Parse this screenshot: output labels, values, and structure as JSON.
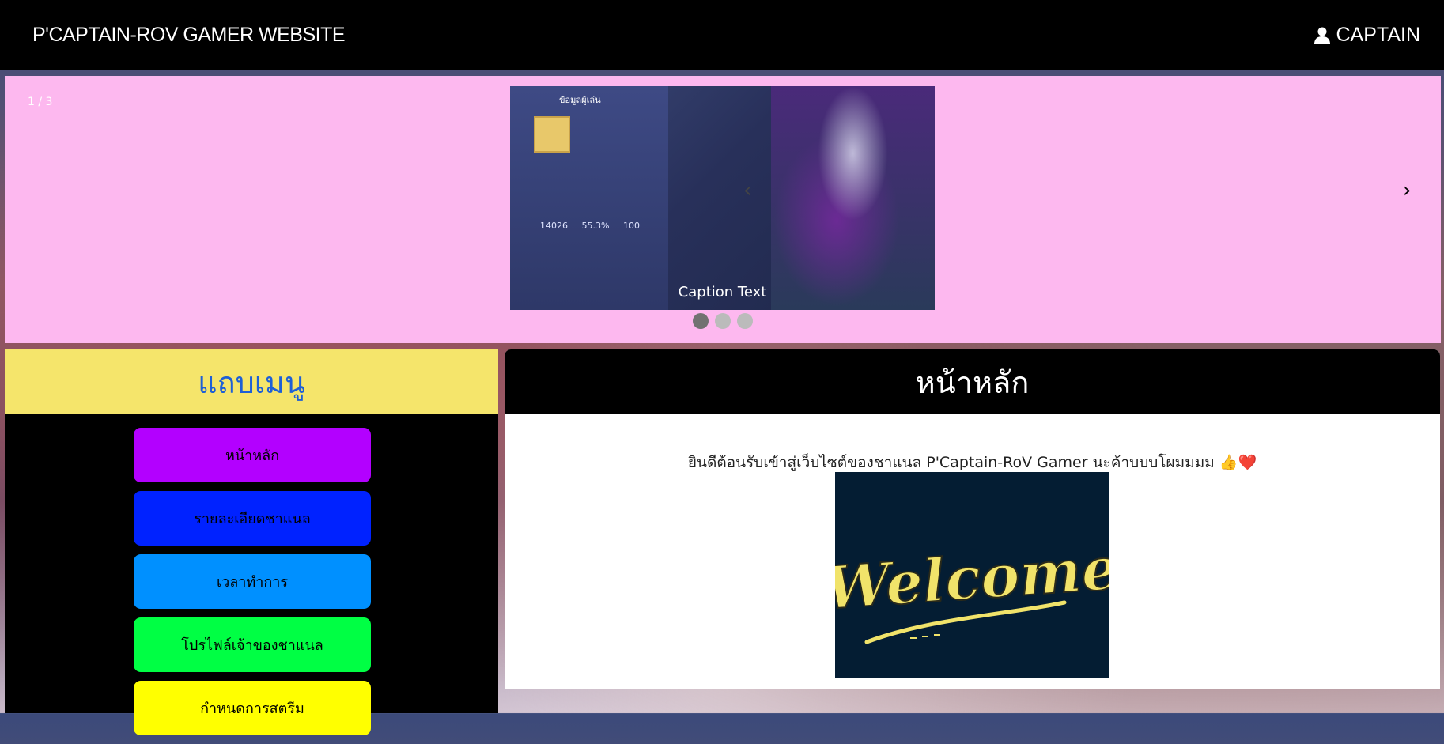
{
  "header": {
    "site_title": "P'CAPTAIN-ROV GAMER WEBSITE",
    "user_label": "CAPTAIN"
  },
  "slideshow": {
    "counter": "1 / 3",
    "caption": "Caption Text",
    "prev_symbol": "‹",
    "next_symbol": "›",
    "slide_count": 3,
    "active_index": 1,
    "game_ui": {
      "player_title": "ข้อมูลผู้เล่น",
      "stats": [
        "14026",
        "55.3%",
        "100"
      ]
    }
  },
  "sidebar": {
    "title": "แถบเมนู",
    "items": [
      {
        "label": "หน้าหลัก",
        "color": "#b300ff"
      },
      {
        "label": "รายละเอียดชาแนล",
        "color": "#0022ff"
      },
      {
        "label": "เวลาทำการ",
        "color": "#0090ff"
      },
      {
        "label": "โปรไฟล์เจ้าของชาแนล",
        "color": "#00ff44"
      },
      {
        "label": "กำหนดการสตรีม",
        "color": "#ffff00"
      }
    ]
  },
  "main": {
    "title": "หน้าหลัก",
    "welcome_text": "ยินดีต้อนรับเข้าสู่เว็บไซต์ของชาแนล P'Captain-RoV Gamer นะค้าบบบโผมมมม 👍❤️",
    "welcome_image_text": "Welcome"
  },
  "colors": {
    "slideshow_bg": "#fdb8ef",
    "sidebar_header_bg": "#f5e56b",
    "sidebar_title": "#1e5fd6"
  }
}
